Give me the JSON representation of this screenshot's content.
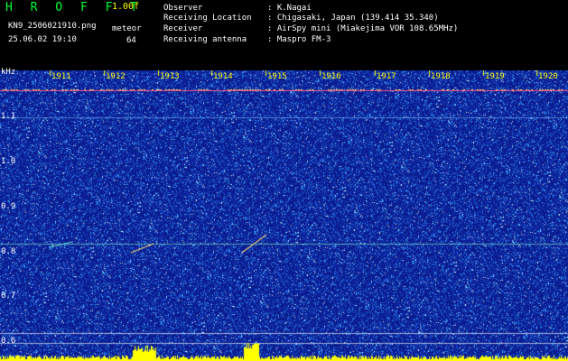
{
  "header": {
    "app_title": "H R O F F T",
    "version": "1.00f",
    "filename": "KN9_2506021910.png",
    "datetime": "25.06.02 19:10",
    "mode_label": "meteor",
    "mode_value": "64"
  },
  "station": [
    {
      "label": "Observer",
      "value": ": K.Nagai"
    },
    {
      "label": "Receiving Location",
      "value": ": Chigasaki, Japan (139.414 35.340)"
    },
    {
      "label": "Receiver",
      "value": ": AirSpy mini (Miakejima VOR 108.65MHz)"
    },
    {
      "label": "Receiving antenna",
      "value": ": Maspro FM-3"
    }
  ],
  "y_axis": {
    "unit": "kHz",
    "ticks": [
      "1.1",
      "1.0",
      "0.9",
      "0.8",
      "0.7",
      "0.6"
    ]
  },
  "x_axis": {
    "ticks": [
      "1911",
      "1912",
      "1913",
      "1914",
      "1915",
      "1916",
      "1917",
      "1918",
      "1919",
      "1920"
    ]
  },
  "colors": {
    "background": "#0a1a8c",
    "noise": "#4aa0ff",
    "marker": "#ffff00",
    "carrier": "#ff5a8a"
  }
}
